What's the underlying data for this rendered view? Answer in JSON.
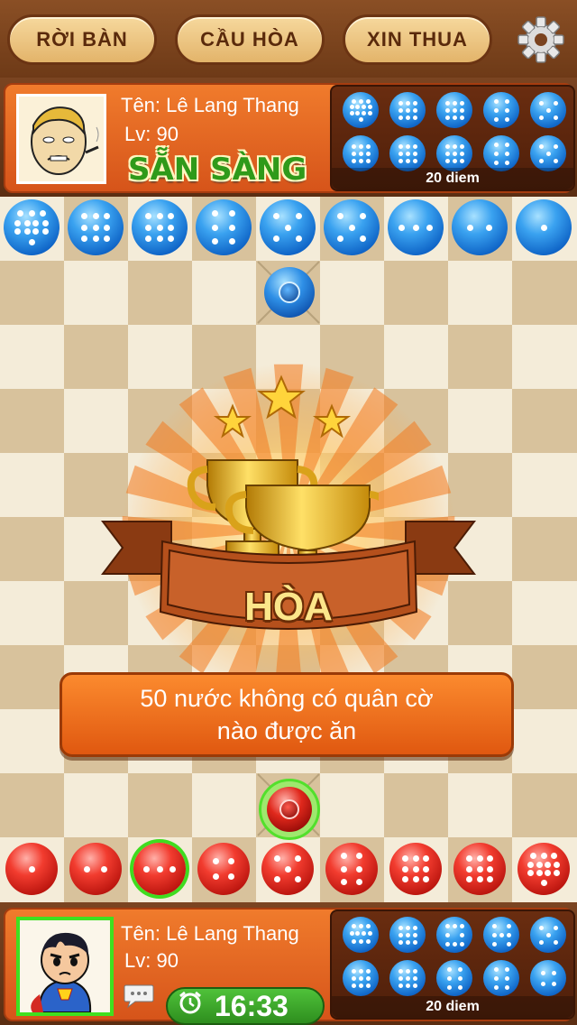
{
  "toolbar": {
    "leave_label": "RỜI BÀN",
    "draw_label": "CẦU HÒA",
    "resign_label": "XIN THUA",
    "settings_icon": "gear-icon"
  },
  "opponent": {
    "name": "Tên: Lê Lang Thang",
    "level": "Lv: 90",
    "status": "SẴN SÀNG",
    "captured": [
      12,
      9,
      9,
      6,
      5,
      9,
      9,
      9,
      6,
      5
    ],
    "points": "20 diem"
  },
  "player": {
    "name": "Tên: Lê Lang Thang",
    "level": "Lv: 90",
    "timer": "16:33",
    "captured": [
      10,
      9,
      8,
      7,
      5,
      9,
      9,
      6,
      6,
      4
    ],
    "points": "20 diem"
  },
  "board": {
    "blue_row": [
      12,
      9,
      9,
      6,
      5,
      5,
      3,
      2,
      1
    ],
    "red_row": [
      1,
      2,
      3,
      4,
      5,
      6,
      9,
      9,
      12
    ],
    "selected_red_index": 2
  },
  "result": {
    "title": "HÒA",
    "message_line1": "50 nước không có quân cờ",
    "message_line2": "nào được ăn"
  },
  "colors": {
    "panel_orange": "#e8661f",
    "pill_tan": "#f0cc8a",
    "timer_green": "#3aa82a",
    "ready_green": "#2f9a1a"
  }
}
